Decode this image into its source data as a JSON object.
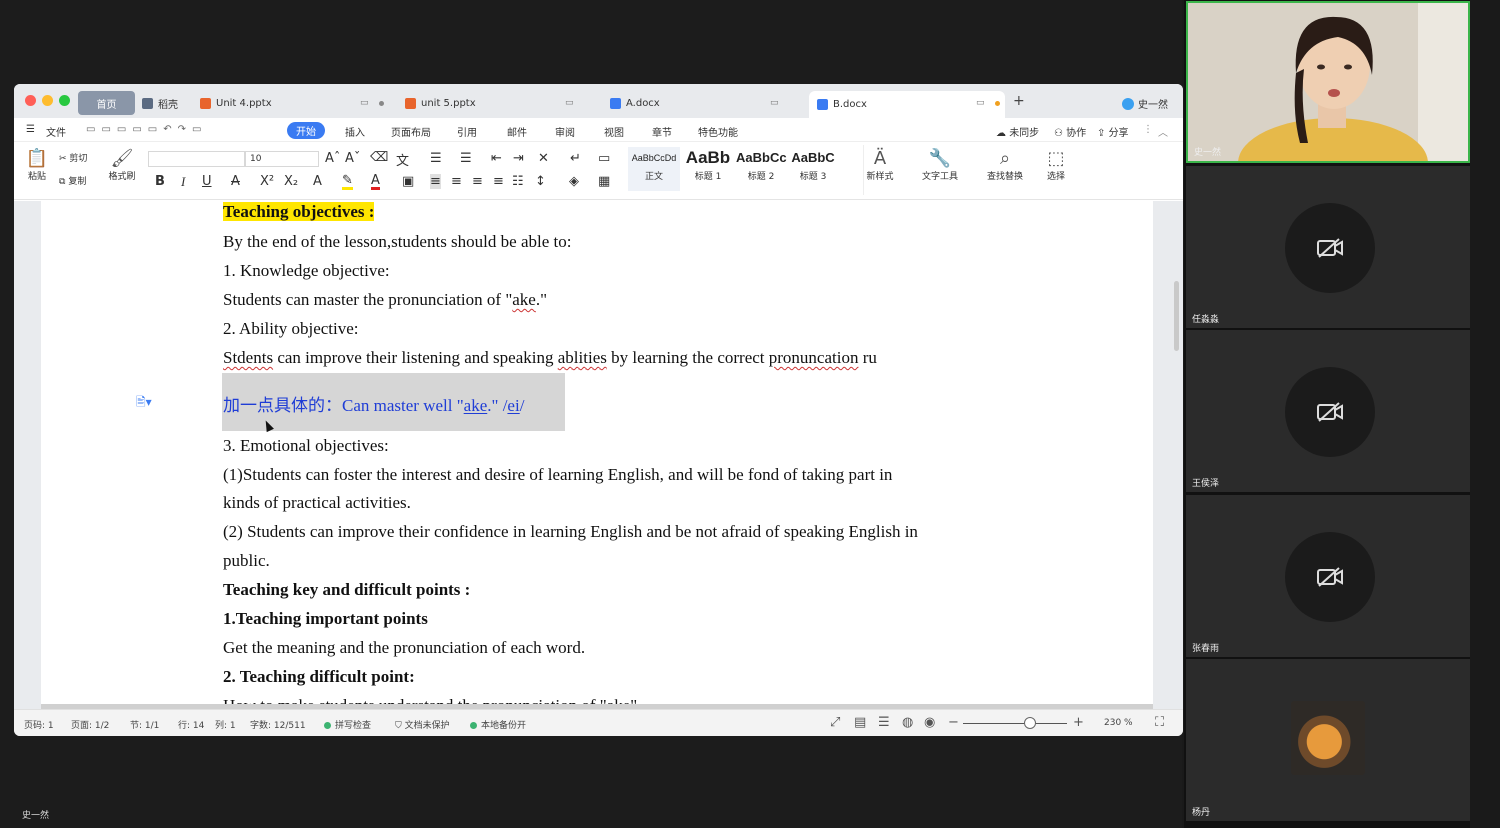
{
  "meeting": {
    "presenter_label": "史一然"
  },
  "window": {
    "tabs": [
      {
        "label": "首页"
      },
      {
        "label": "稻壳"
      },
      {
        "label": "Unit 4.pptx"
      },
      {
        "label": "unit 5.pptx"
      },
      {
        "label": "A.docx"
      },
      {
        "label": "B.docx"
      }
    ],
    "new_tab_symbol": "+",
    "user_name": "史一然"
  },
  "menu": {
    "file": "文件",
    "items": [
      "开始",
      "插入",
      "页面布局",
      "引用",
      "邮件",
      "审阅",
      "视图",
      "章节",
      "特色功能"
    ],
    "sync": "未同步",
    "collab": "协作",
    "share": "分享"
  },
  "ribbon": {
    "paste": "粘贴",
    "cut": "剪切",
    "copy": "复制",
    "format_painter": "格式刷",
    "font_size": "10",
    "styles": [
      {
        "sample": "AaBbCcDd",
        "label": "正文"
      },
      {
        "sample": "AaBb",
        "label": "标题 1"
      },
      {
        "sample": "AaBbCc",
        "label": "标题 2"
      },
      {
        "sample": "AaBbC",
        "label": "标题 3"
      }
    ],
    "new_style": "新样式",
    "text_tools": "文字工具",
    "find_replace": "查找替换",
    "select": "选择"
  },
  "document": {
    "l1": "Teaching objectives :",
    "l2": "By the end of the lesson,students should be able to:",
    "l3": "1. Knowledge objective:",
    "l4a": "Students can master the pronunciation of \"",
    "l4b": "ake",
    "l4c": ".\"",
    "l5": "2. Ability objective:",
    "l6a": "Stdents",
    "l6b": " can improve their listening and speaking ",
    "l6c": "ablities",
    "l6d": " by learning the correct ",
    "l6e": "pronuncation",
    "l6f": " ru",
    "l7a": "加一点具体的：Can master well \"",
    "l7b": "ake",
    "l7c": ".\" /",
    "l7d": "ei",
    "l7e": "/",
    "l8": "3. Emotional objectives:",
    "l9": "(1)Students can foster the interest and desire of learning English, and will be fond of taking part in",
    "l10": "kinds of practical activities.",
    "l11": "(2) Students can improve their confidence in learning English and be not afraid of speaking English in",
    "l12": "public.",
    "l13": "Teaching key and difficult points :",
    "l14": "1.Teaching important points",
    "l15": "Get the meaning and the pronunciation of each word.",
    "l16": "2. Teaching difficult point:",
    "l17": "How to make students understand the pronunciation of \"ake\""
  },
  "status": {
    "page_no": "页码: 1",
    "pages": "页面: 1/2",
    "section": "节: 1/1",
    "row": "行: 14",
    "col": "列: 1",
    "words": "字数: 12/511",
    "spell": "拼写检查",
    "protect": "文档未保护",
    "backup": "本地备份开",
    "zoom": "230 %"
  },
  "participants": [
    {
      "name": "史一然",
      "camera": "on"
    },
    {
      "name": "任淼淼",
      "camera": "off"
    },
    {
      "name": "王侯泽",
      "camera": "off"
    },
    {
      "name": "张春雨",
      "camera": "off"
    },
    {
      "name": "杨丹",
      "camera": "avatar"
    }
  ],
  "colors": {
    "accent": "#3a7bf2",
    "highlight": "#ffe600",
    "active_speaker": "#3bb54a"
  }
}
